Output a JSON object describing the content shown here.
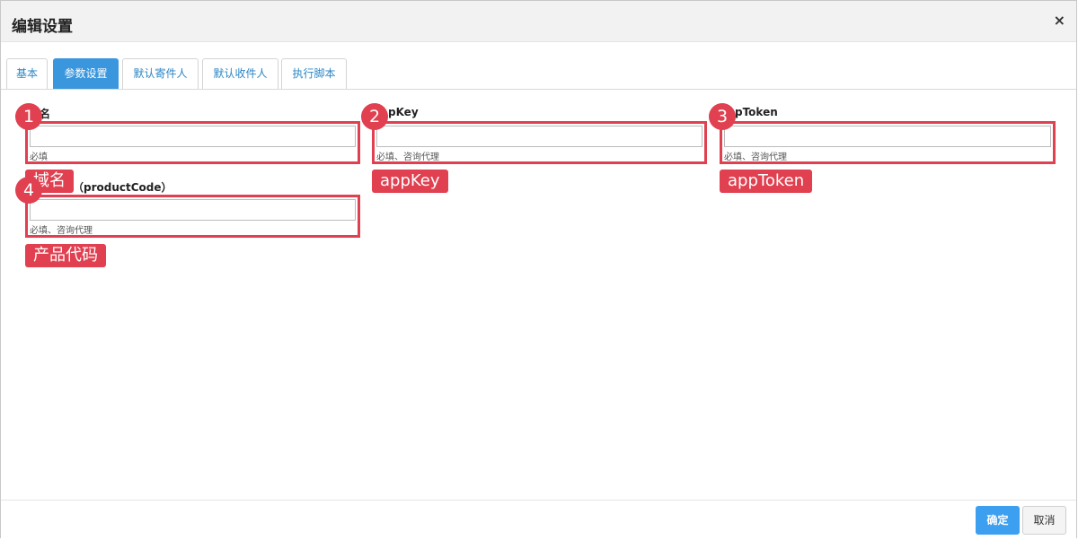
{
  "dialog": {
    "title": "编辑设置",
    "close_glyph": "×"
  },
  "tabs": [
    {
      "label": "基本"
    },
    {
      "label": "参数设置",
      "active": true
    },
    {
      "label": "默认寄件人"
    },
    {
      "label": "默认收件人"
    },
    {
      "label": "执行脚本"
    }
  ],
  "fields": [
    {
      "number": "1",
      "label": "名",
      "hint": "必填",
      "tag": "域名"
    },
    {
      "number": "2",
      "label": "pKey",
      "hint": "必填、咨询代理",
      "tag": "appKey"
    },
    {
      "number": "3",
      "label": "pToken",
      "hint": "必填、咨询代理",
      "tag": "appToken"
    },
    {
      "number": "4",
      "label": "（productCode）",
      "hint": "必填、咨询代理",
      "tag": "产品代码"
    }
  ],
  "footer": {
    "ok_label": "确定",
    "cancel_label": "取消"
  },
  "colors": {
    "accent": "#3a97dd",
    "annotation": "#e04050"
  }
}
